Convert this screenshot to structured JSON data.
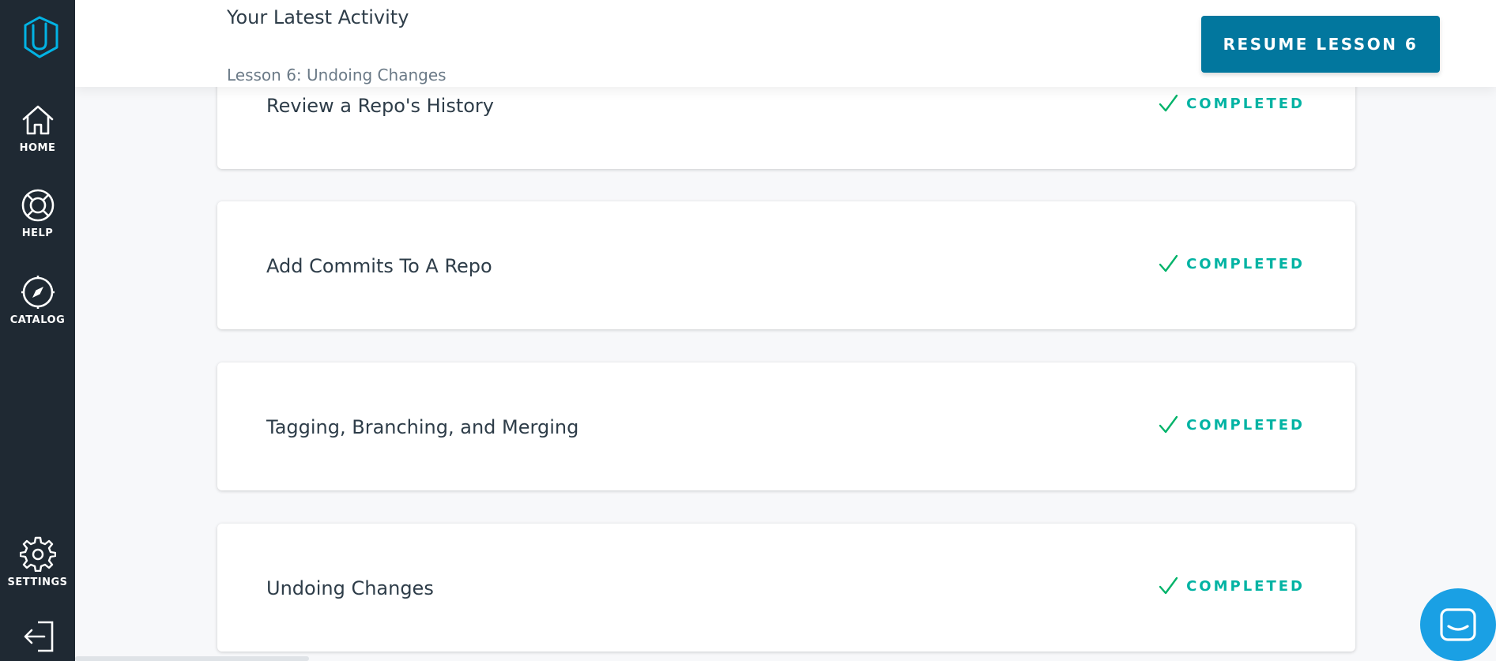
{
  "header": {
    "title": "Your Latest Activity",
    "subtitle": "Lesson 6: Undoing Changes",
    "resume_label": "RESUME LESSON 6"
  },
  "sidebar": {
    "items": [
      {
        "label": "HOME",
        "icon": "home-icon"
      },
      {
        "label": "HELP",
        "icon": "lifebuoy-icon"
      },
      {
        "label": "CATALOG",
        "icon": "compass-icon"
      },
      {
        "label": "SETTINGS",
        "icon": "gear-icon"
      },
      {
        "label": "",
        "icon": "logout-icon"
      }
    ]
  },
  "lessons": [
    {
      "title": "Review a Repo's History",
      "status": "COMPLETED"
    },
    {
      "title": "Add Commits To A Repo",
      "status": "COMPLETED"
    },
    {
      "title": "Tagging, Branching, and Merging",
      "status": "COMPLETED"
    },
    {
      "title": "Undoing Changes",
      "status": "COMPLETED"
    }
  ],
  "colors": {
    "sidebar": "#1f2933",
    "accent": "#02779e",
    "completed": "#02b3a3",
    "logo": "#02b3e4",
    "chat": "#1aa0e4"
  }
}
